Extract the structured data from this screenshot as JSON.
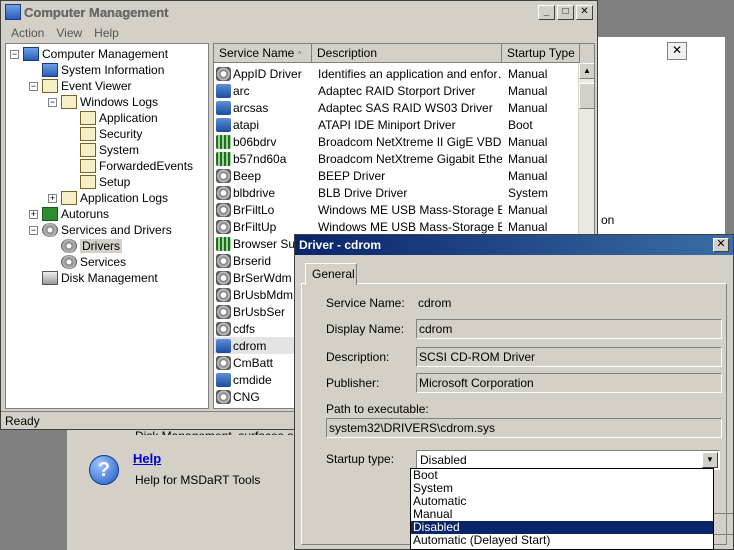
{
  "background_window": {
    "side_text": "on",
    "truncated_text": "Disk Management, surfaces and",
    "help_title": "Help",
    "help_desc": "Help for MSDaRT Tools",
    "close_glyph": "✕"
  },
  "computer_management": {
    "title": "Computer Management",
    "menu": [
      "Action",
      "View",
      "Help"
    ],
    "status": "Ready",
    "tree": [
      {
        "label": "Computer Management",
        "indent": 0,
        "expander": "−",
        "icon": "computer-icon"
      },
      {
        "label": "System Information",
        "indent": 1,
        "expander": "",
        "icon": "system-info-icon"
      },
      {
        "label": "Event Viewer",
        "indent": 1,
        "expander": "−",
        "icon": "event-log-icon"
      },
      {
        "label": "Windows Logs",
        "indent": 2,
        "expander": "−",
        "icon": "event-log-icon"
      },
      {
        "label": "Application",
        "indent": 3,
        "expander": "",
        "icon": "event-log-icon"
      },
      {
        "label": "Security",
        "indent": 3,
        "expander": "",
        "icon": "event-log-icon"
      },
      {
        "label": "System",
        "indent": 3,
        "expander": "",
        "icon": "event-log-icon"
      },
      {
        "label": "ForwardedEvents",
        "indent": 3,
        "expander": "",
        "icon": "event-log-icon"
      },
      {
        "label": "Setup",
        "indent": 3,
        "expander": "",
        "icon": "event-log-icon"
      },
      {
        "label": "Application Logs",
        "indent": 2,
        "expander": "+",
        "icon": "event-log-icon"
      },
      {
        "label": "Autoruns",
        "indent": 1,
        "expander": "+",
        "icon": "autoruns-icon"
      },
      {
        "label": "Services and Drivers",
        "indent": 1,
        "expander": "−",
        "icon": "services-icon"
      },
      {
        "label": "Drivers",
        "indent": 2,
        "expander": "",
        "icon": "gear-icon",
        "selected": true
      },
      {
        "label": "Services",
        "indent": 2,
        "expander": "",
        "icon": "gear-icon"
      },
      {
        "label": "Disk Management",
        "indent": 1,
        "expander": "",
        "icon": "disk-icon"
      }
    ],
    "columns": [
      "Service Name",
      "Description",
      "Startup Type"
    ],
    "sort_glyph": "^",
    "rows": [
      {
        "name": "AppID Driver",
        "desc": "Identifies an application and enfor…",
        "type": "Manual",
        "icon": "gear"
      },
      {
        "name": "arc",
        "desc": "Adaptec RAID Storport Driver",
        "type": "Manual",
        "icon": "device"
      },
      {
        "name": "arcsas",
        "desc": "Adaptec SAS RAID WS03 Driver",
        "type": "Manual",
        "icon": "device"
      },
      {
        "name": "atapi",
        "desc": "ATAPI IDE Miniport Driver",
        "type": "Boot",
        "icon": "device"
      },
      {
        "name": "b06bdrv",
        "desc": "Broadcom NetXtreme II GigE VBD",
        "type": "Manual",
        "icon": "net"
      },
      {
        "name": "b57nd60a",
        "desc": "Broadcom NetXtreme Gigabit Ether…",
        "type": "Manual",
        "icon": "net"
      },
      {
        "name": "Beep",
        "desc": "BEEP Driver",
        "type": "Manual",
        "icon": "gear"
      },
      {
        "name": "blbdrive",
        "desc": "BLB Drive Driver",
        "type": "System",
        "icon": "gear"
      },
      {
        "name": "BrFiltLo",
        "desc": "Windows ME USB Mass-Storage Bu…",
        "type": "Manual",
        "icon": "gear"
      },
      {
        "name": "BrFiltUp",
        "desc": "Windows ME USB Mass-Storage Bu…",
        "type": "Manual",
        "icon": "gear"
      },
      {
        "name": "Browser Supp",
        "desc": "",
        "type": "",
        "icon": "net"
      },
      {
        "name": "Brserid",
        "desc": "",
        "type": "",
        "icon": "gear"
      },
      {
        "name": "BrSerWdm",
        "desc": "",
        "type": "",
        "icon": "gear"
      },
      {
        "name": "BrUsbMdm",
        "desc": "",
        "type": "",
        "icon": "gear"
      },
      {
        "name": "BrUsbSer",
        "desc": "",
        "type": "",
        "icon": "gear"
      },
      {
        "name": "cdfs",
        "desc": "",
        "type": "",
        "icon": "gear"
      },
      {
        "name": "cdrom",
        "desc": "",
        "type": "",
        "icon": "device",
        "selected": true
      },
      {
        "name": "CmBatt",
        "desc": "",
        "type": "",
        "icon": "gear"
      },
      {
        "name": "cmdide",
        "desc": "",
        "type": "",
        "icon": "computer"
      },
      {
        "name": "CNG",
        "desc": "",
        "type": "",
        "icon": "gear"
      }
    ]
  },
  "driver_dialog": {
    "title": "Driver - cdrom",
    "tab": "General",
    "service_name_label": "Service Name:",
    "service_name": "cdrom",
    "display_name_label": "Display Name:",
    "display_name": "cdrom",
    "description_label": "Description:",
    "description": "SCSI CD-ROM Driver",
    "publisher_label": "Publisher:",
    "publisher": "Microsoft Corporation",
    "path_label": "Path to executable:",
    "path": "system32\\DRIVERS\\cdrom.sys",
    "startup_label": "Startup type:",
    "startup_value": "Disabled",
    "startup_options": [
      "Boot",
      "System",
      "Automatic",
      "Manual",
      "Disabled",
      "Automatic (Delayed Start)"
    ],
    "selected_option": "Disabled"
  }
}
